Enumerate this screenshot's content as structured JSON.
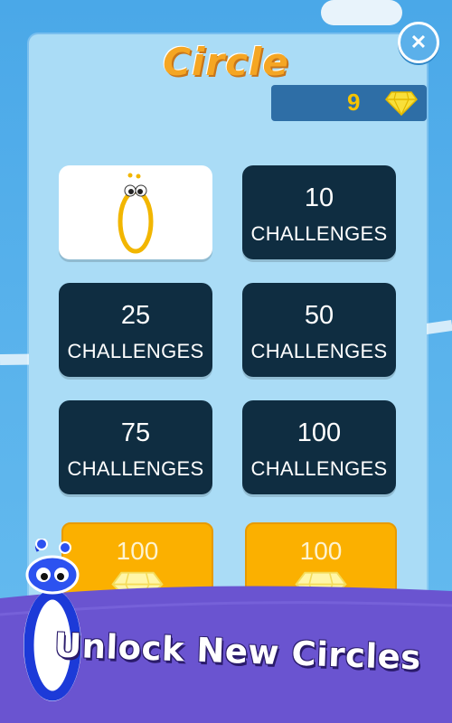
{
  "screen": {
    "title": "Circle",
    "close_icon": "close-x-icon",
    "gem_count": "9",
    "gem_icon": "diamond-icon"
  },
  "tiles": [
    {
      "number": "10",
      "label": "CHALLENGES"
    },
    {
      "number": "25",
      "label": "CHALLENGES"
    },
    {
      "number": "50",
      "label": "CHALLENGES"
    },
    {
      "number": "75",
      "label": "CHALLENGES"
    },
    {
      "number": "100",
      "label": "CHALLENGES"
    }
  ],
  "purchase_tiles": [
    {
      "price": "100",
      "icon": "diamond-icon"
    },
    {
      "price": "100",
      "icon": "diamond-icon"
    }
  ],
  "banner": {
    "text": "Unlock New Circles"
  },
  "colors": {
    "tile_dark": "#0f2d41",
    "gold": "#fbb000",
    "purple_band": "#6a54d0",
    "title_orange": "#f5a623"
  }
}
